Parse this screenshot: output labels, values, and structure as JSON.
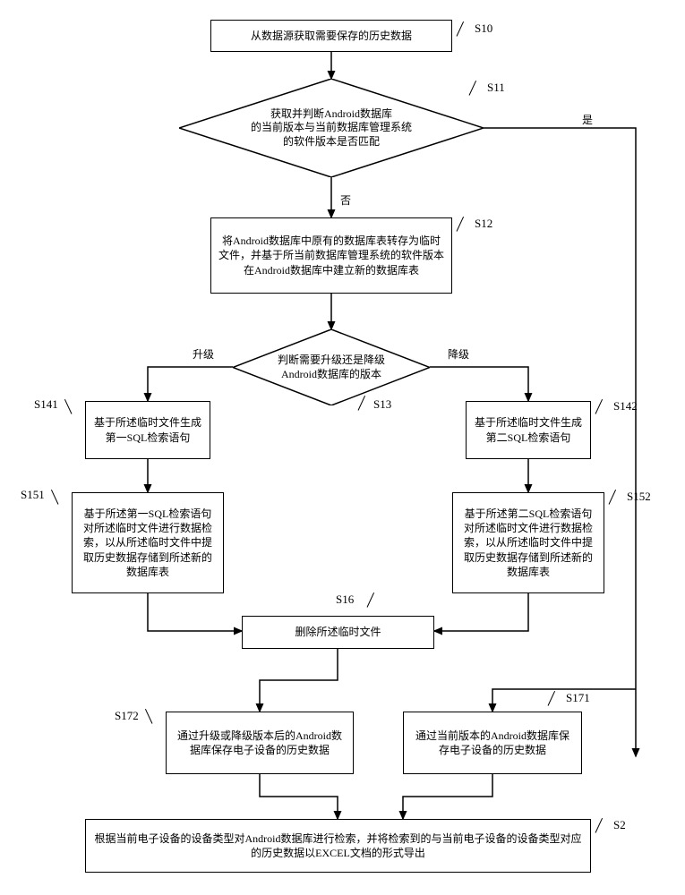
{
  "chart_data": {
    "type": "flowchart",
    "title": "",
    "nodes": [
      {
        "id": "S10",
        "shape": "rect",
        "text": "从数据源获取需要保存的历史数据"
      },
      {
        "id": "S11",
        "shape": "diamond",
        "text": "获取并判断Android数据库的当前版本与当前数据库管理系统的软件版本是否匹配"
      },
      {
        "id": "S12",
        "shape": "rect",
        "text": "将Android数据库中原有的数据库表转存为临时文件，并基于所当前数据库管理系统的软件版本在Android数据库中建立新的数据库表"
      },
      {
        "id": "S13",
        "shape": "diamond",
        "text": "判断需要升级还是降级Android数据库的版本"
      },
      {
        "id": "S141",
        "shape": "rect",
        "text": "基于所述临时文件生成第一SQL检索语句"
      },
      {
        "id": "S142",
        "shape": "rect",
        "text": "基于所述临时文件生成第二SQL检索语句"
      },
      {
        "id": "S151",
        "shape": "rect",
        "text": "基于所述第一SQL检索语句对所述临时文件进行数据检索，以从所述临时文件中提取历史数据存储到所述新的数据库表"
      },
      {
        "id": "S152",
        "shape": "rect",
        "text": "基于所述第二SQL检索语句对所述临时文件进行数据检索，以从所述临时文件中提取历史数据存储到所述新的数据库表"
      },
      {
        "id": "S16",
        "shape": "rect",
        "text": "删除所述临时文件"
      },
      {
        "id": "S172",
        "shape": "rect",
        "text": "通过升级或降级版本后的Android数据库保存电子设备的历史数据"
      },
      {
        "id": "S171",
        "shape": "rect",
        "text": "通过当前版本的Android数据库保存电子设备的历史数据"
      },
      {
        "id": "S2",
        "shape": "rect",
        "text": "根据当前电子设备的设备类型对Android数据库进行检索，并将检索到的与当前电子设备的设备类型对应的历史数据以EXCEL文档的形式导出"
      }
    ],
    "edges": [
      {
        "from": "S10",
        "to": "S11",
        "label": ""
      },
      {
        "from": "S11",
        "to": "S12",
        "label": "否"
      },
      {
        "from": "S11",
        "to": "S171",
        "label": "是"
      },
      {
        "from": "S12",
        "to": "S13",
        "label": ""
      },
      {
        "from": "S13",
        "to": "S141",
        "label": "升级"
      },
      {
        "from": "S13",
        "to": "S142",
        "label": "降级"
      },
      {
        "from": "S141",
        "to": "S151",
        "label": ""
      },
      {
        "from": "S142",
        "to": "S152",
        "label": ""
      },
      {
        "from": "S151",
        "to": "S16",
        "label": ""
      },
      {
        "from": "S152",
        "to": "S16",
        "label": ""
      },
      {
        "from": "S16",
        "to": "S172",
        "label": ""
      },
      {
        "from": "S171",
        "to": "S2",
        "label": ""
      },
      {
        "from": "S172",
        "to": "S2",
        "label": ""
      }
    ]
  },
  "labels": {
    "yes": "是",
    "no": "否",
    "upgrade": "升级",
    "downgrade": "降级"
  },
  "steps": {
    "s10": "S10",
    "s11": "S11",
    "s12": "S12",
    "s13": "S13",
    "s141": "S141",
    "s142": "S142",
    "s151": "S151",
    "s152": "S152",
    "s16": "S16",
    "s171": "S171",
    "s172": "S172",
    "s2": "S2"
  },
  "text": {
    "b_s10": "从数据源获取需要保存的历史数据",
    "d_s11": "获取并判断Android数据库<br>的当前版本与当前数据库管理系统<br>的软件版本是否匹配",
    "b_s12": "将Android数据库中原有的数据库表转存为临时文件，并基于所当前数据库管理系统的软件版本在Android数据库中建立新的数据库表",
    "d_s13": "判断需要升级还是降级<br>Android数据库的版本",
    "b_s141": "基于所述临时文件生成第一SQL检索语句",
    "b_s142": "基于所述临时文件生成第二SQL检索语句",
    "b_s151": "基于所述第一SQL检索语句对所述临时文件进行数据检索，以从所述临时文件中提取历史数据存储到所述新的数据库表",
    "b_s152": "基于所述第二SQL检索语句对所述临时文件进行数据检索，以从所述临时文件中提取历史数据存储到所述新的数据库表",
    "b_s16": "删除所述临时文件",
    "b_s172": "通过升级或降级版本后的Android数据库保存电子设备的历史数据",
    "b_s171": "通过当前版本的Android数据库保存电子设备的历史数据",
    "b_s2": "根据当前电子设备的设备类型对Android数据库进行检索，并将检索到的与当前电子设备的设备类型对应的历史数据以EXCEL文档的形式导出"
  }
}
